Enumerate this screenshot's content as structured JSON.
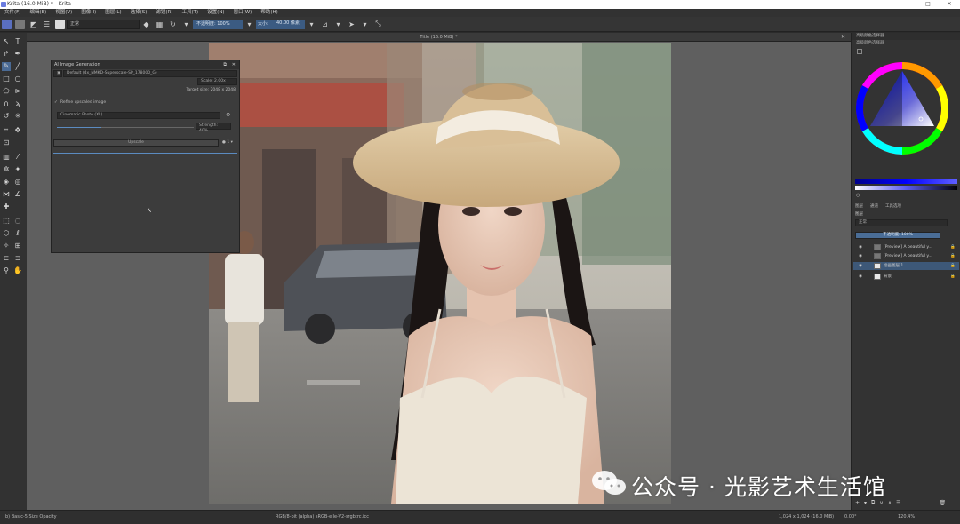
{
  "window": {
    "title": "Krita (16.0 MiB) * - Krita",
    "controls": [
      "—",
      "□",
      "✕"
    ]
  },
  "menu": [
    "文件(F)",
    "编辑(E)",
    "视图(V)",
    "图像(I)",
    "图层(L)",
    "选择(S)",
    "滤镜(R)",
    "工具(T)",
    "设置(N)",
    "窗口(W)",
    "帮助(H)"
  ],
  "toolbar": {
    "blend_mode": "正常",
    "opacity_label": "不透明度: 100%",
    "size_label": "大小:",
    "size_value": "40.00 像素"
  },
  "document": {
    "tab_title": "Title (16.0 MiB) *"
  },
  "ai_panel": {
    "title": "AI Image Generation",
    "model": "Default (4x_NMKD-Superscale-SP_178000_G)",
    "scale": "Scale: 2.00x",
    "target_size": "Target size: 2048 x 2048",
    "refine_label": "Refine upscaled image",
    "style": "Cinematic Photo (XL)",
    "strength": "Strength: 40%",
    "upscale_button": "Upscale"
  },
  "right_dock": {
    "color_selector_title": "高级颜色选择器",
    "tabs": [
      "图层",
      "通道",
      "工具选项"
    ],
    "layer_mode": "正常",
    "layer_opacity": "不透明度: 100%",
    "layers": [
      {
        "name": "[Preview] A beautiful y...",
        "selected": false
      },
      {
        "name": "[Preview] A beautiful y...",
        "selected": false
      },
      {
        "name": "绘画图层 1",
        "selected": true
      },
      {
        "name": "背景",
        "selected": false
      }
    ]
  },
  "status": {
    "brush": "b) Basic-5 Size Opacity",
    "color_space": "RGB/8-bit (alpha) sRGB-elle-V2-srgbtrc.icc",
    "image_size": "1,024 x 1,024 (16.0 MiB)",
    "rotation": "0.00°",
    "zoom": "120.4%"
  },
  "watermark": {
    "text": "公众号 · 光影艺术生活馆"
  },
  "colors": {
    "accent": "#3b5b82",
    "selected_layer": "#3d5878",
    "panel_bg": "#3c3c3c"
  }
}
